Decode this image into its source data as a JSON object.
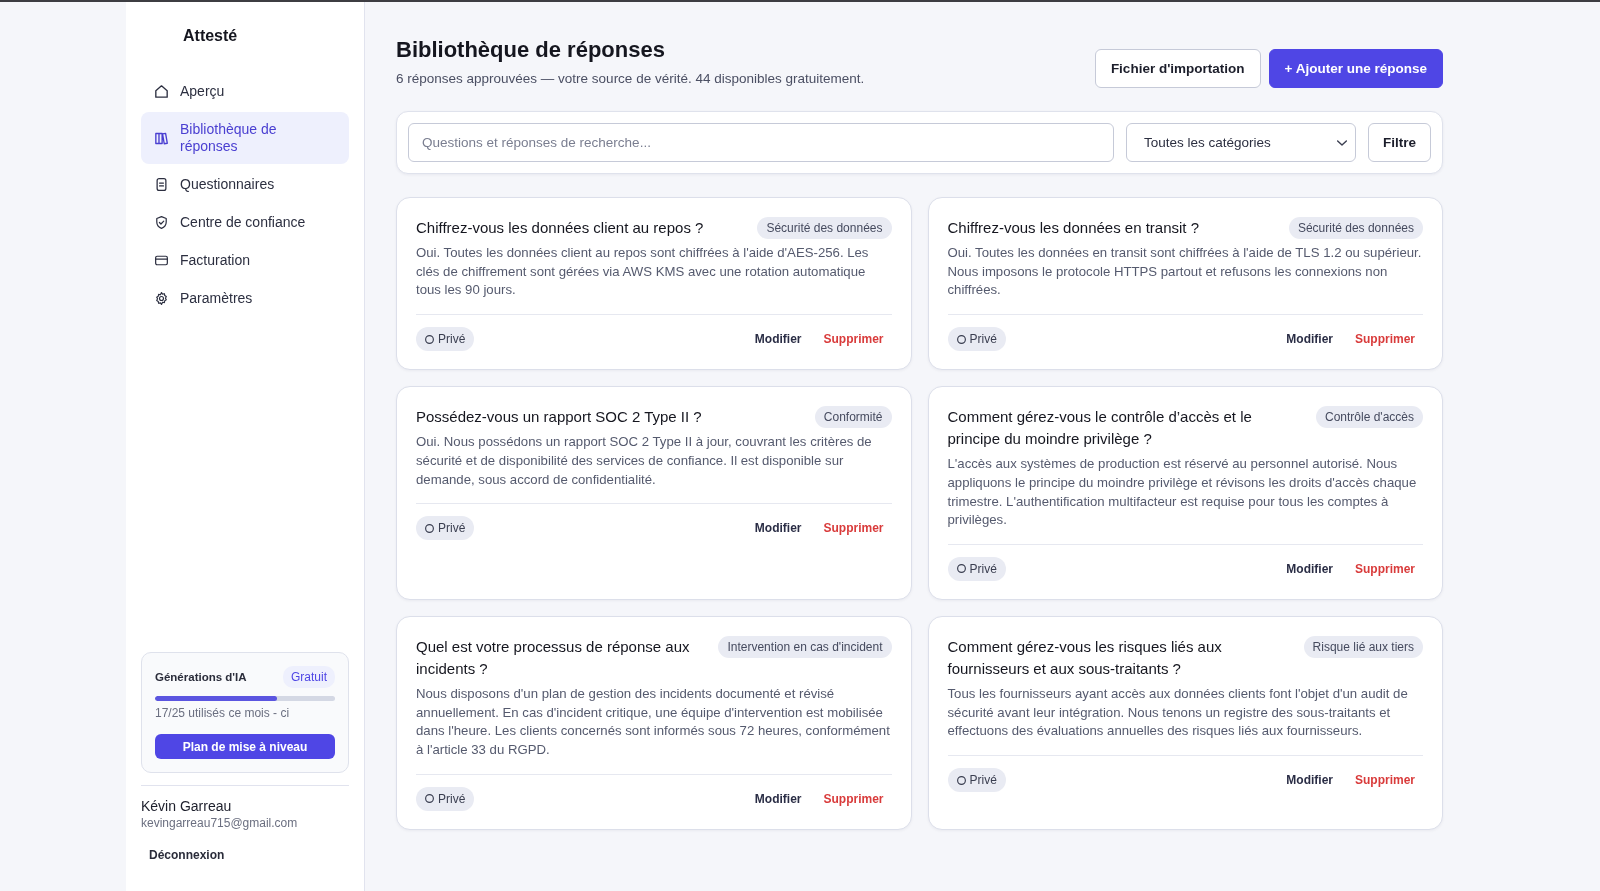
{
  "sidebar": {
    "brand": "Attesté",
    "nav_items": [
      {
        "label": "Aperçu",
        "selected": false
      },
      {
        "label": "Bibliothèque de réponses",
        "selected": true
      },
      {
        "label": "Questionnaires",
        "selected": false
      },
      {
        "label": "Centre de confiance",
        "selected": false
      },
      {
        "label": "Facturation",
        "selected": false
      },
      {
        "label": "Paramètres",
        "selected": false
      }
    ],
    "usage_card": {
      "title": "Générations d'IA",
      "plan_badge": "Gratuit",
      "level": 0.68,
      "usage_text": "17/25 utilisés ce mois - ci",
      "upgrade_button": "Plan de mise à niveau"
    },
    "user": {
      "name": "Kévin Garreau",
      "email": "kevingarreau715@gmail.com"
    },
    "logout_button": "Déconnexion"
  },
  "header": {
    "title": "Bibliothèque de réponses",
    "subtitle": "6 réponses approuvées — votre source de vérité. 44 disponibles gratuitement.",
    "buttons": [
      {
        "label": "Fichier d'importation",
        "kind": "secondary"
      },
      {
        "label": "+ Ajouter une réponse",
        "kind": "primary"
      }
    ]
  },
  "filters": {
    "search": {
      "placeholder": "Questions et réponses de recherche..."
    },
    "category_select": "Toutes les catégories",
    "filter_button": "Filtre"
  },
  "answers": [
    {
      "question": "Chiffrez-vous les données client au repos ?",
      "category": "Sécurité des données",
      "answer": "Oui. Toutes les données client au repos sont chiffrées à l'aide d'AES-256. Les clés de chiffrement sont gérées via AWS KMS avec une rotation automatique tous les 90 jours.",
      "visibility": "Privé",
      "edit_button": "Modifier",
      "delete_button": "Supprimer"
    },
    {
      "question": "Chiffrez-vous les données en transit ?",
      "category": "Sécurité des données",
      "answer": "Oui. Toutes les données en transit sont chiffrées à l'aide de TLS 1.2 ou supérieur. Nous imposons le protocole HTTPS partout et refusons les connexions non chiffrées.",
      "visibility": "Privé",
      "edit_button": "Modifier",
      "delete_button": "Supprimer"
    },
    {
      "question": "Possédez-vous un rapport SOC 2 Type II ?",
      "category": "Conformité",
      "answer": "Oui. Nous possédons un rapport SOC 2 Type II à jour, couvrant les critères de sécurité et de disponibilité des services de confiance. Il est disponible sur demande, sous accord de confidentialité.",
      "visibility": "Privé",
      "edit_button": "Modifier",
      "delete_button": "Supprimer"
    },
    {
      "question": "Comment gérez-vous le contrôle d’accès et le principe du moindre privilège ?",
      "category": "Contrôle d'accès",
      "answer": "L'accès aux systèmes de production est réservé au personnel autorisé. Nous appliquons le principe du moindre privilège et révisons les droits d'accès chaque trimestre. L'authentification multifacteur est requise pour tous les comptes à privilèges.",
      "visibility": "Privé",
      "edit_button": "Modifier",
      "delete_button": "Supprimer"
    },
    {
      "question": "Quel est votre processus de réponse aux incidents ?",
      "category": "Intervention en cas d'incident",
      "answer": "Nous disposons d'un plan de gestion des incidents documenté et révisé annuellement. En cas d'incident critique, une équipe d'intervention est mobilisée dans l'heure. Les clients concernés sont informés sous 72 heures, conformément à l'article 33 du RGPD.",
      "visibility": "Privé",
      "edit_button": "Modifier",
      "delete_button": "Supprimer"
    },
    {
      "question": "Comment gérez-vous les risques liés aux fournisseurs et aux sous-traitants ?",
      "category": "Risque lié aux tiers",
      "answer": "Tous les fournisseurs ayant accès aux données clients font l'objet d'un audit de sécurité avant leur intégration. Nous tenons un registre des sous-traitants et effectuons des évaluations annuelles des risques liés aux fournisseurs.",
      "visibility": "Privé",
      "edit_button": "Modifier",
      "delete_button": "Supprimer"
    }
  ]
}
